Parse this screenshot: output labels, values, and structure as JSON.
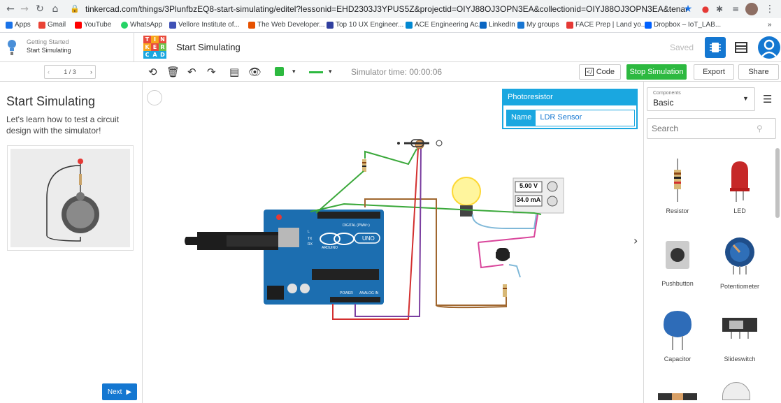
{
  "browser": {
    "url": "tinkercad.com/things/3PlunfbzEQ8-start-simulating/editel?lessonid=EHD2303J3YPUS5Z&projectid=OIYJ88OJ3OPN3EA&collectionid=OIYJ88OJ3OPN3EA&tenant=circuits#/lesson-viewer",
    "bookmarks": [
      "Apps",
      "Gmail",
      "YouTube",
      "WhatsApp",
      "Vellore Institute of...",
      "The Web Developer...",
      "Top 10 UX Engineer...",
      "ACE Engineering Ac...",
      "LinkedIn",
      "My groups",
      "FACE Prep | Land yo...",
      "Dropbox – IoT_LAB..."
    ],
    "bookmark_more": "»"
  },
  "header": {
    "lesson_group": "Getting Started",
    "lesson_name": "Start Simulating",
    "logo_letters": [
      "T",
      "I",
      "N",
      "K",
      "E",
      "R",
      "C",
      "A",
      "D"
    ],
    "title": "Start Simulating",
    "saved_label": "Saved"
  },
  "toolbar": {
    "pager": "1 / 3",
    "simulator_time": "Simulator time: 00:00:06",
    "code_label": "Code",
    "stop_label": "Stop Simulation",
    "export_label": "Export",
    "share_label": "Share"
  },
  "lesson": {
    "heading": "Start Simulating",
    "body": "Let's learn how to test a circuit design with the simulator!",
    "next_label": "Next"
  },
  "inspector": {
    "title": "Photoresistor",
    "name_label": "Name",
    "name_value": "LDR Sensor"
  },
  "multimeter": {
    "voltage": "5.00 V",
    "current": "34.0 mA"
  },
  "arduino": {
    "digital_label": "DIGITAL (PWM~)",
    "brand": "ARDUINO",
    "model": "UNO",
    "power_label": "POWER",
    "analog_label": "ANALOG IN",
    "tx": "TX",
    "rx": "RX",
    "l": "L"
  },
  "components": {
    "category_caption": "Components",
    "category_value": "Basic",
    "search_placeholder": "Search",
    "items": [
      {
        "label": "Resistor"
      },
      {
        "label": "LED"
      },
      {
        "label": "Pushbutton"
      },
      {
        "label": "Potentiometer"
      },
      {
        "label": "Capacitor"
      },
      {
        "label": "Slideswitch"
      }
    ]
  },
  "colors": {
    "accent": "#1477d1",
    "stop": "#2db940",
    "wire_green": "#3aa83a",
    "wire_brown": "#a0672f",
    "wire_red": "#d32f2f",
    "wire_purple": "#7b3fa0",
    "wire_pink": "#d9459b",
    "wire_blue": "#7fb8d8",
    "board": "#1c6eb0"
  }
}
